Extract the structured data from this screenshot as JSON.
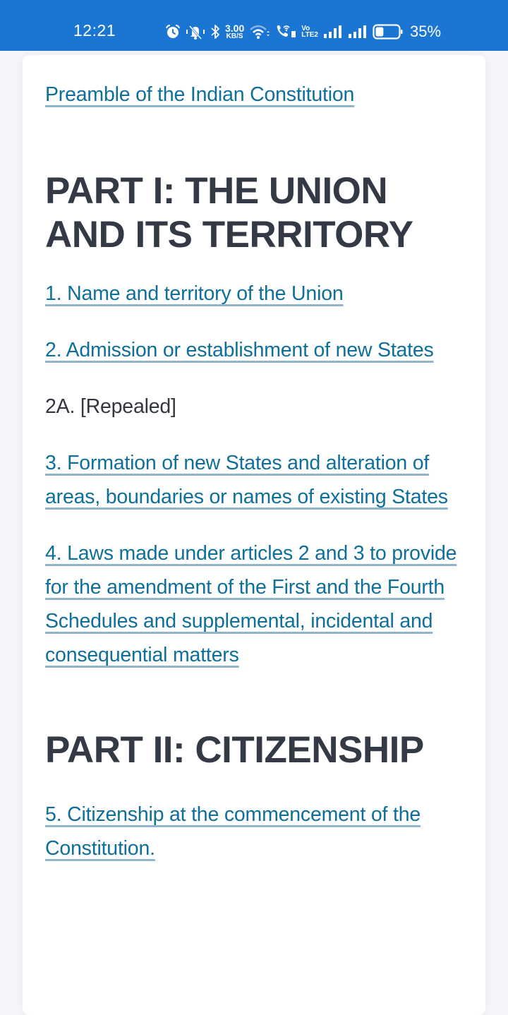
{
  "status_bar": {
    "time": "12:21",
    "icons": [
      "alarm-icon",
      "mute-vibrate-icon",
      "bluetooth-icon",
      "net-speed",
      "wifi-icon",
      "wifi-calling-icon",
      "volte-icon",
      "signal-icon-sim1",
      "signal-icon-sim2",
      "battery-icon"
    ],
    "net_speed_value": "3.00",
    "net_speed_unit": "KB/S",
    "volte_top": "Vo",
    "volte_bottom": "LTE2",
    "battery_percent": "35%",
    "battery_level": 0.35,
    "background_color": "#1b76d3"
  },
  "content": {
    "preamble_link": "Preamble of the Indian Constitution",
    "parts": [
      {
        "title": "PART I: THE UNION AND ITS TERRITORY",
        "articles": [
          {
            "text": "1. Name and territory of the Union",
            "is_link": true
          },
          {
            "text": "2. Admission or establishment of new States",
            "is_link": true
          },
          {
            "text": "2A. [Repealed]",
            "is_link": false
          },
          {
            "text": "3. Formation of new States and alteration of areas, boundaries or names of existing States",
            "is_link": true
          },
          {
            "text": "4. Laws made under articles 2 and 3 to provide for the amendment of the First and the Fourth Schedules and supplemental, incidental and consequential matters",
            "is_link": true
          }
        ]
      },
      {
        "title": "PART II: CITIZENSHIP",
        "articles": [
          {
            "text": "5. Citizenship at the commencement of the Constitution.",
            "is_link": true
          }
        ]
      }
    ]
  },
  "colors": {
    "link": "#0f6f9b",
    "link_underline": "#8fb6cc",
    "heading": "#343a45",
    "plain_text": "#333640",
    "page_background": "#f5f6f9"
  }
}
